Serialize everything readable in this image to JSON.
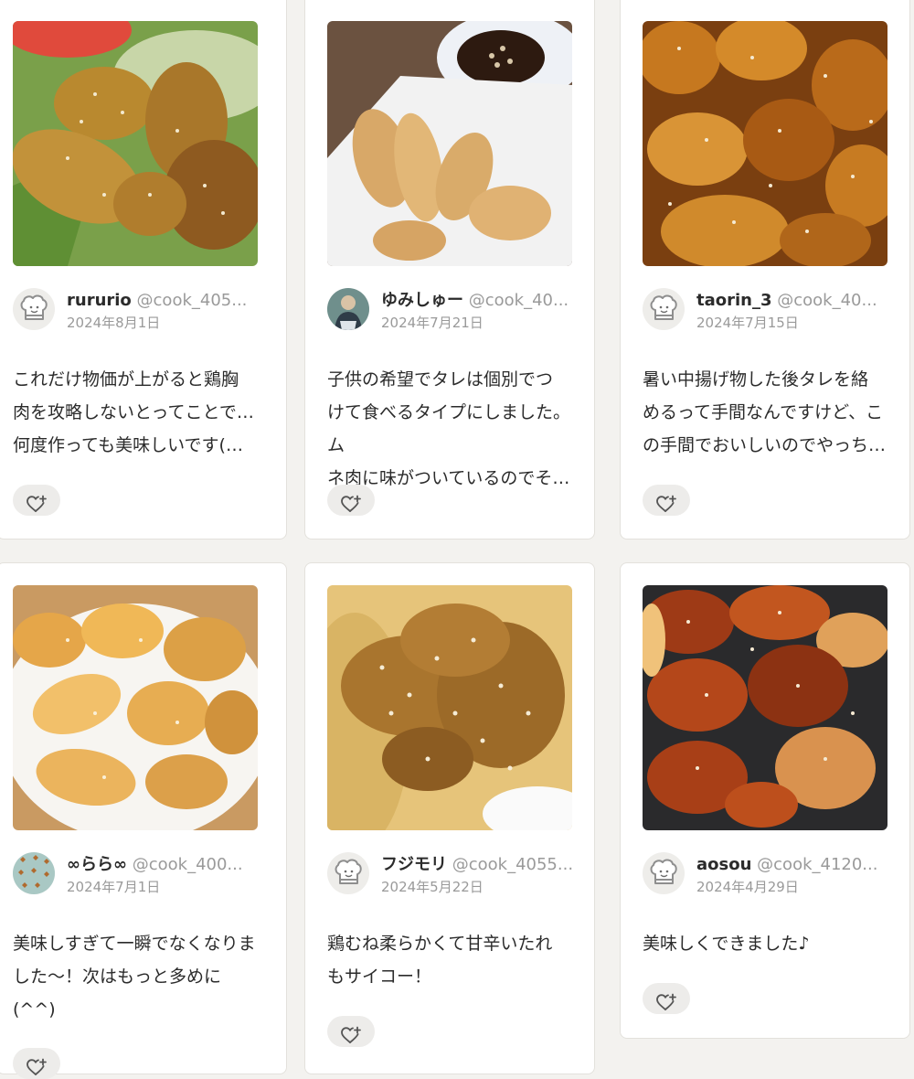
{
  "colors": {
    "page_bg": "#f3f2ef",
    "card_bg": "#ffffff",
    "muted_text": "#9a9a9a",
    "like_bg": "#edecea"
  },
  "posts": [
    {
      "username": "rururio",
      "handle": "@cook_405...",
      "date": "2024年8月1日",
      "comment_lines": [
        "これだけ物価が上がると鶏胸",
        "肉を攻略しないとってことで…",
        "何度作っても美味しいです(…"
      ],
      "avatar": "chef-hat-icon",
      "photo": "karaage with lettuce and tomato",
      "like_icon": "heart-plus-icon"
    },
    {
      "username": "ゆみしゅー",
      "handle": "@cook_40...",
      "date": "2024年7月21日",
      "comment_lines": [
        "子供の希望でタレは個別でつ",
        "けて食べるタイプにしました。ム",
        "ネ肉に味がついているのでそ…"
      ],
      "avatar": "user-photo",
      "photo": "fried chicken on white plate with dipping sauce",
      "like_icon": "heart-plus-icon"
    },
    {
      "username": "taorin_3",
      "handle": "@cook_40...",
      "date": "2024年7月15日",
      "comment_lines": [
        "暑い中揚げ物した後タレを絡",
        "めるって手間なんですけど、こ",
        "の手間でおいしいのでやっち…"
      ],
      "avatar": "chef-hat-icon",
      "photo": "glazed chicken with sesame",
      "like_icon": "heart-plus-icon"
    },
    {
      "username": "∞らら∞",
      "handle": "@cook_400...",
      "date": "2024年7月1日",
      "comment_lines": [
        "美味しすぎて一瞬でなくなりま",
        "した〜！次はもっと多めに",
        "(^^)"
      ],
      "avatar": "user-pattern",
      "photo": "chicken pieces in white bowl",
      "like_icon": "heart-plus-icon"
    },
    {
      "username": "フジモリ",
      "handle": "@cook_4055...",
      "date": "2024年5月22日",
      "comment_lines": [
        "鶏むね柔らかくて甘辛いたれ",
        "もサイコー！"
      ],
      "avatar": "chef-hat-icon",
      "photo": "chicken over rice with sesame sauce",
      "like_icon": "heart-plus-icon"
    },
    {
      "username": "aosou",
      "handle": "@cook_4120...",
      "date": "2024年4月29日",
      "comment_lines": [
        "美味しくできました♪"
      ],
      "avatar": "chef-hat-icon",
      "photo": "spicy red glazed chicken in pan",
      "like_icon": "heart-plus-icon"
    }
  ]
}
